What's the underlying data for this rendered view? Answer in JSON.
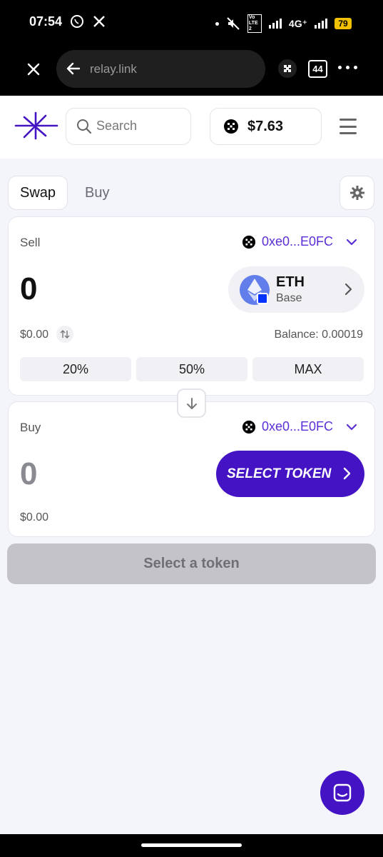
{
  "status_bar": {
    "time": "07:54",
    "network": "4G⁺",
    "volte": "Vo LTE 2",
    "battery": "79"
  },
  "browser": {
    "url": "relay.link",
    "tab_count": "44"
  },
  "header": {
    "search_placeholder": "Search",
    "wallet_balance": "$7.63"
  },
  "tabs": [
    {
      "label": "Swap",
      "active": true
    },
    {
      "label": "Buy",
      "active": false
    }
  ],
  "sell": {
    "label": "Sell",
    "address": "0xe0...E0FC",
    "amount": "0",
    "token": {
      "symbol": "ETH",
      "chain": "Base"
    },
    "usd_value": "$0.00",
    "balance": "Balance: 0.00019",
    "percent_buttons": [
      "20%",
      "50%",
      "MAX"
    ]
  },
  "buy": {
    "label": "Buy",
    "address": "0xe0...E0FC",
    "amount": "0",
    "select_token_label": "SELECT TOKEN",
    "usd_value": "$0.00"
  },
  "cta_label": "Select a token",
  "colors": {
    "accent": "#4413c4",
    "accent_text": "#5b2fd6",
    "disabled": "#c4c4c8"
  }
}
